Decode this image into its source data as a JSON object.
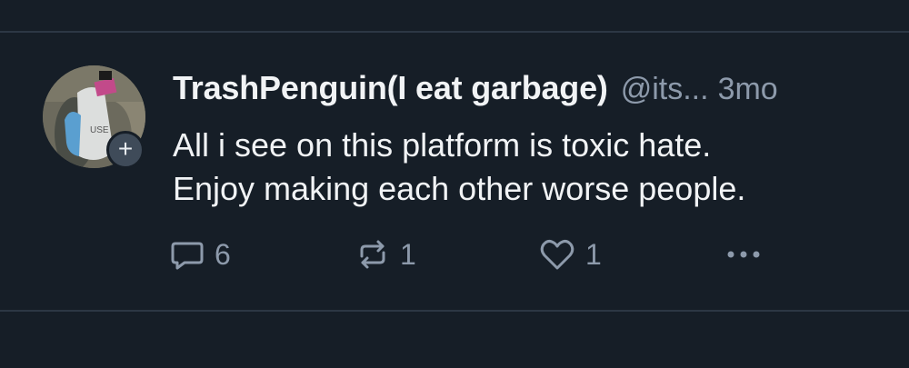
{
  "post": {
    "author": {
      "display_name": "TrashPenguin(I eat garbage)",
      "handle": "@its...",
      "avatar_icon": "user-avatar",
      "follow_icon": "plus-icon",
      "follow_label": "+"
    },
    "timestamp": "3mo",
    "text_lines": [
      "All i see on this platform is toxic hate.",
      "Enjoy making each other worse people."
    ],
    "actions": {
      "reply": {
        "icon": "reply-icon",
        "count": "6"
      },
      "repost": {
        "icon": "repost-icon",
        "count": "1"
      },
      "like": {
        "icon": "heart-icon",
        "count": "1"
      },
      "more": {
        "icon": "more-options-icon"
      }
    }
  },
  "colors": {
    "background": "#161e27",
    "divider": "#2c3744",
    "primary_text": "#f1f3f5",
    "secondary_text": "#8d9aab",
    "badge": "#3f4b59"
  }
}
